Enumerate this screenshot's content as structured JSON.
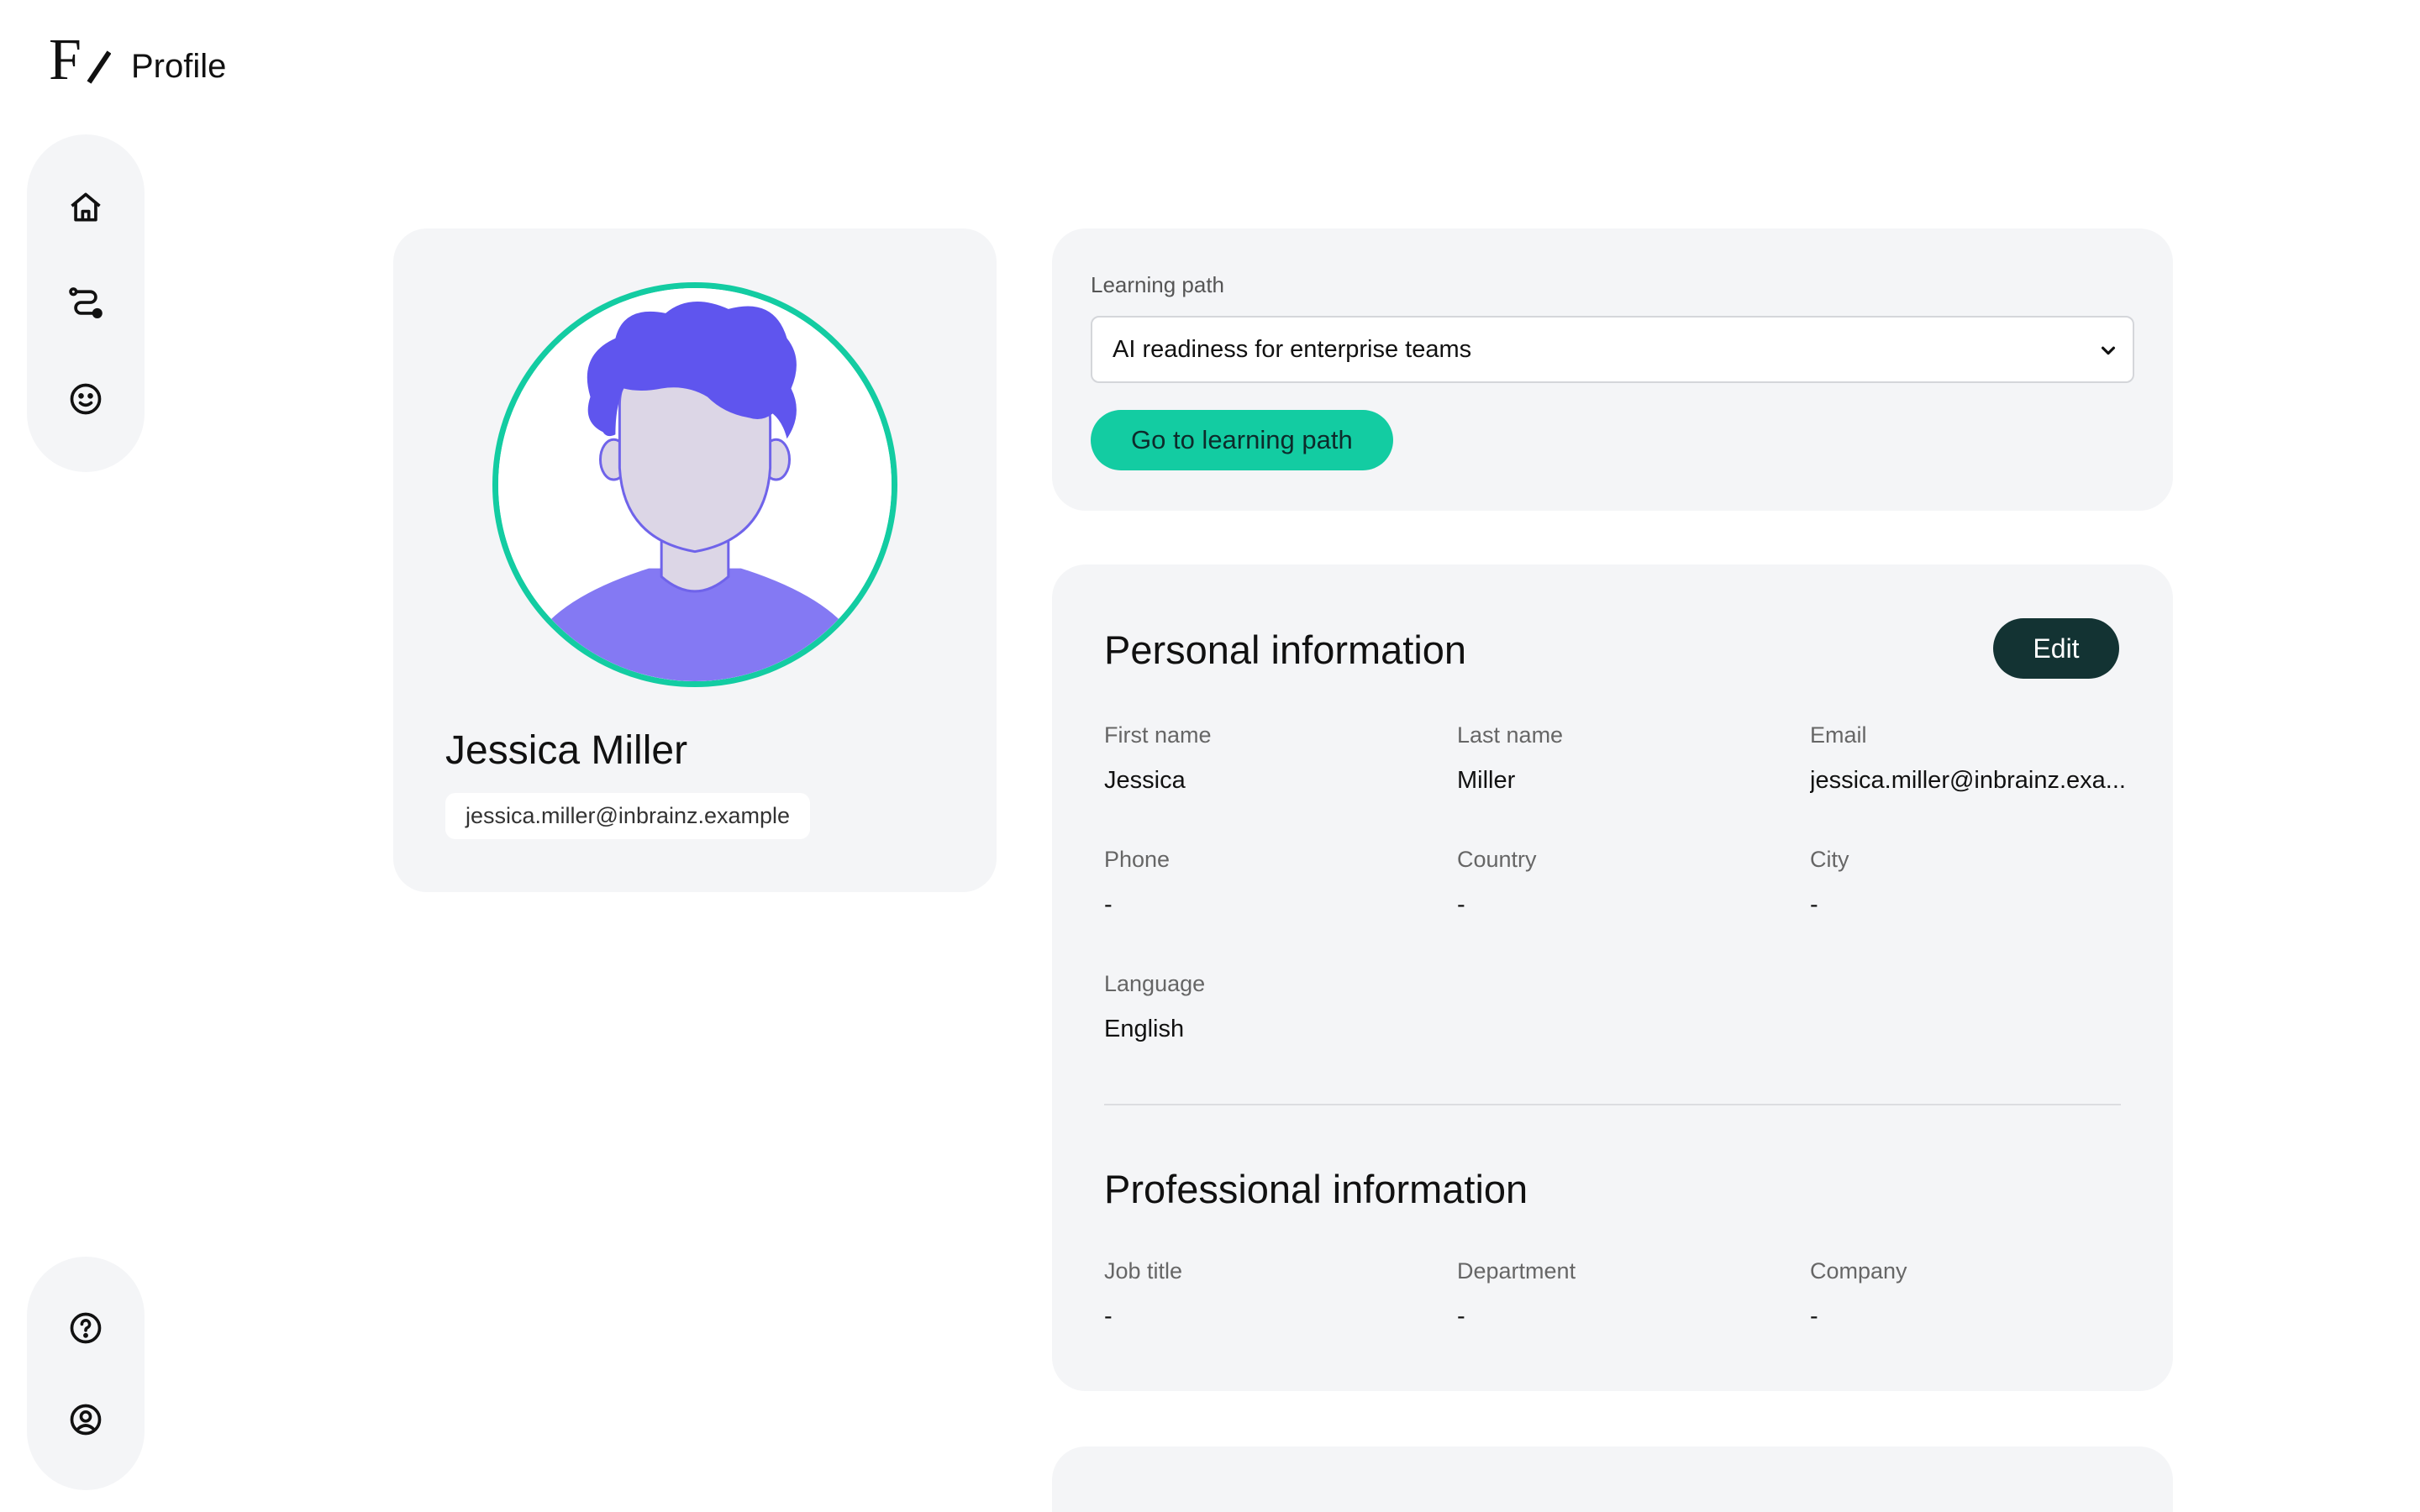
{
  "header": {
    "title": "Profile",
    "logo_text": "F/"
  },
  "rail_top": [
    {
      "icon": "home-icon"
    },
    {
      "icon": "learning-path-icon"
    },
    {
      "icon": "smiley-icon"
    }
  ],
  "rail_bottom": [
    {
      "icon": "help-icon"
    },
    {
      "icon": "user-account-icon"
    }
  ],
  "profile": {
    "name": "Jessica Miller",
    "email": "jessica.miller@inbrainz.example"
  },
  "learning_path": {
    "label": "Learning path",
    "selected": "AI readiness for enterprise teams",
    "button": "Go to learning path"
  },
  "personal": {
    "title": "Personal information",
    "edit_label": "Edit",
    "fields": [
      {
        "label": "First name",
        "value": "Jessica"
      },
      {
        "label": "Last name",
        "value": "Miller"
      },
      {
        "label": "Email",
        "value": "jessica.miller@inbrainz.exa..."
      },
      {
        "label": "Phone",
        "value": "-"
      },
      {
        "label": "Country",
        "value": "-"
      },
      {
        "label": "City",
        "value": "-"
      },
      {
        "label": "Language",
        "value": "English"
      }
    ]
  },
  "professional": {
    "title": "Professional information",
    "fields": [
      {
        "label": "Job title",
        "value": "-"
      },
      {
        "label": "Department",
        "value": "-"
      },
      {
        "label": "Company",
        "value": "-"
      }
    ]
  },
  "colors": {
    "accent": "#13cca2",
    "dark_button": "#133333",
    "card_bg": "#f4f5f7",
    "avatar_hair": "#5f55ee",
    "avatar_shirt": "#8479f3",
    "avatar_skin": "#dcd6e6"
  }
}
